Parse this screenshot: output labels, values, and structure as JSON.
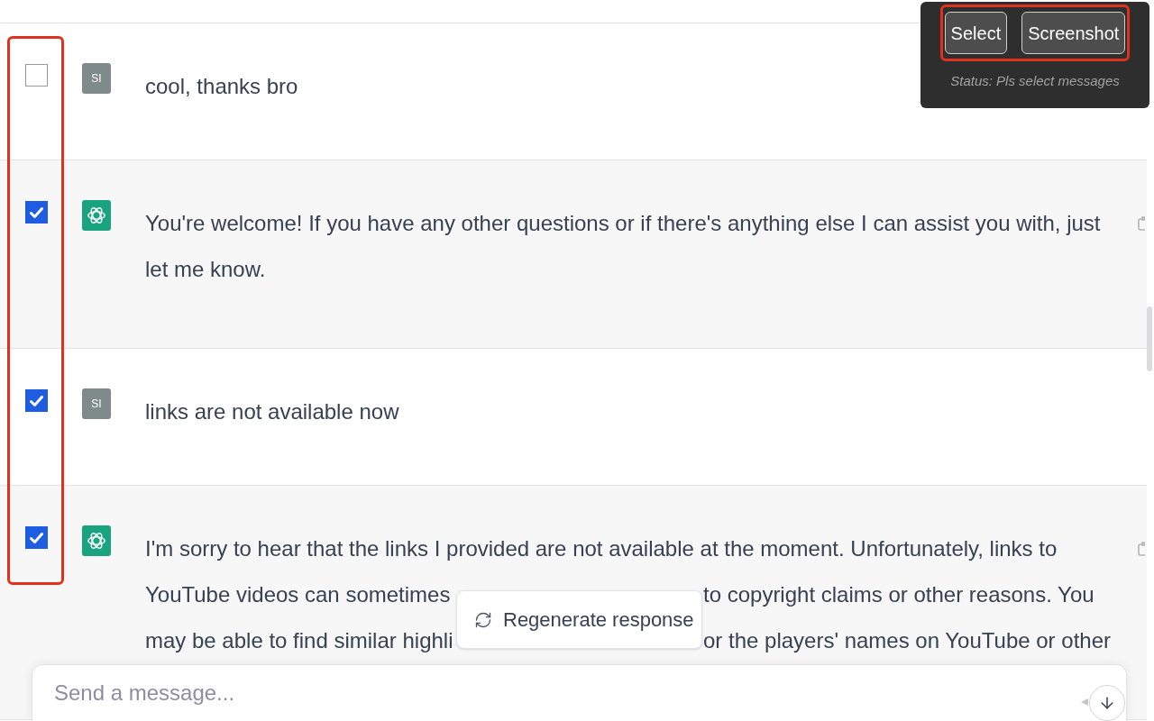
{
  "toolbar": {
    "buttons": [
      "Select",
      "Screenshot"
    ],
    "status": "Status: Pls select messages"
  },
  "messages": [
    {
      "kind": "user",
      "checked": false,
      "avatar": "SI",
      "text": "cool, thanks bro"
    },
    {
      "kind": "assistant",
      "checked": true,
      "text": "You're welcome! If you have any other questions or if there's anything else I can assist you with, just let me know."
    },
    {
      "kind": "user",
      "checked": true,
      "avatar": "SI",
      "text": "links are not available now"
    },
    {
      "kind": "assistant",
      "checked": true,
      "lines": [
        [
          "I'm sorry to hear that the links I provided are not available at the moment. Unfortunately, links to"
        ],
        [
          "YouTube videos can sometimes",
          "to copyright claims or other reasons. You"
        ],
        [
          "may be able to find similar highli",
          "or the players' names on YouTube or other"
        ]
      ]
    }
  ],
  "regenerate_button": "Regenerate response",
  "composer": {
    "placeholder": "Send a message..."
  }
}
